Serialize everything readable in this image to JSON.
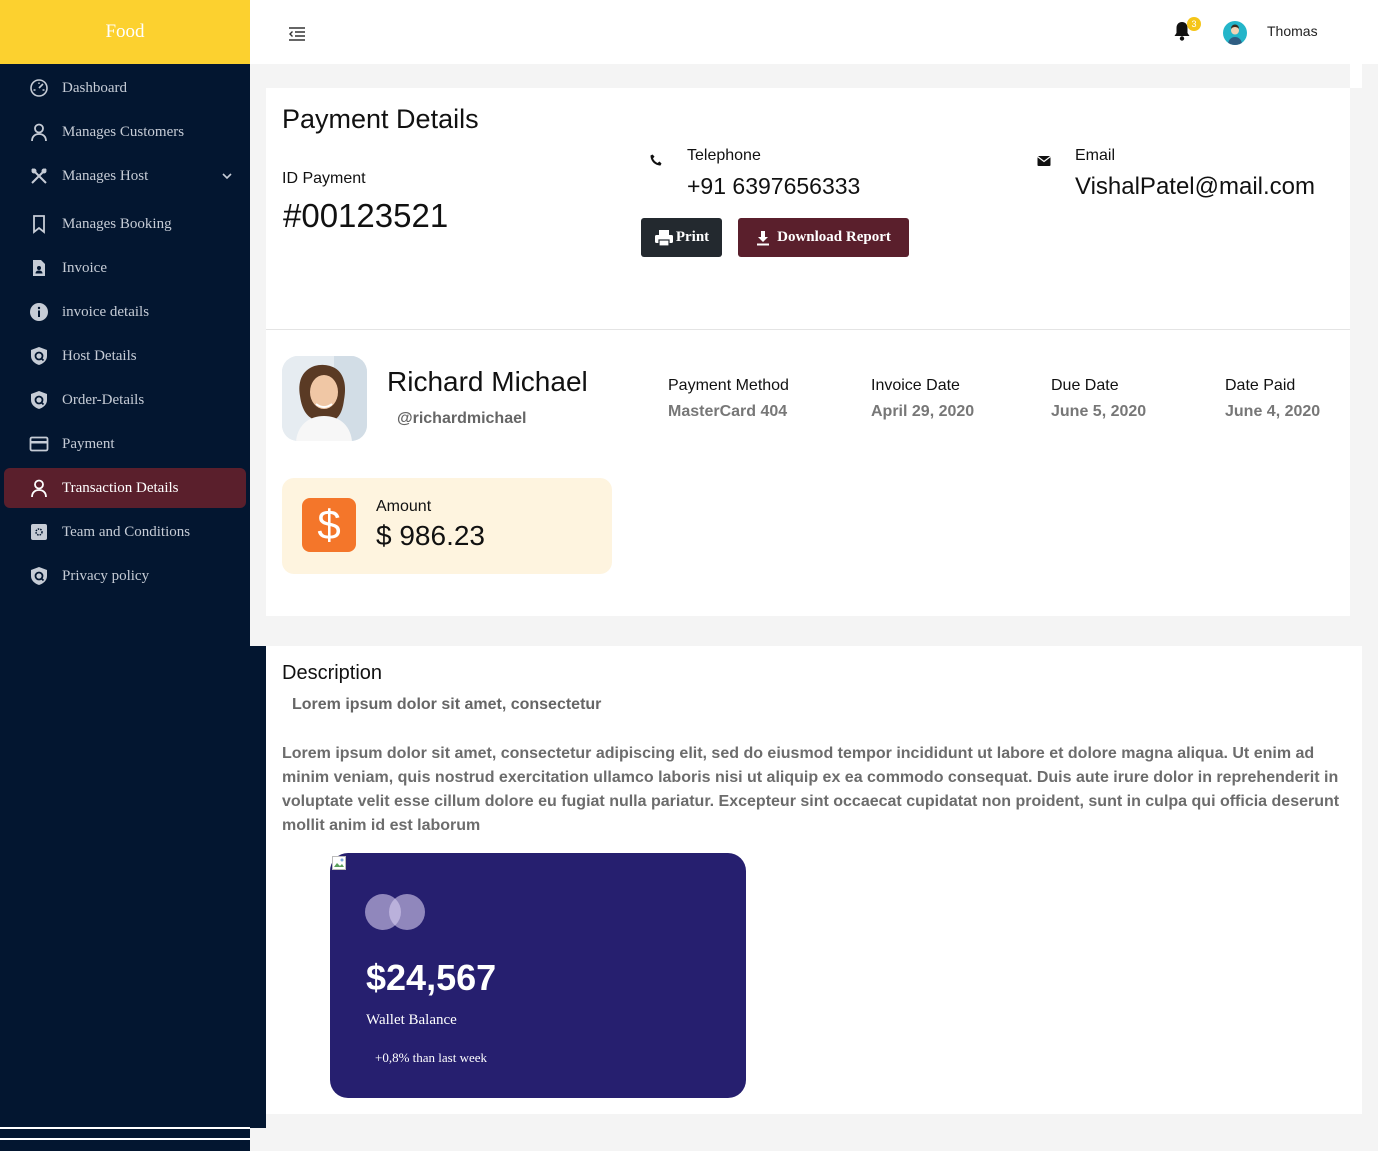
{
  "sidebar": {
    "logo": "Food",
    "items": [
      {
        "label": "Dashboard",
        "icon": "dashboard-gauge-icon"
      },
      {
        "label": "Manages Customers",
        "icon": "user-icon"
      },
      {
        "label": "Manages Host",
        "icon": "utensils-icon"
      },
      {
        "label": "Manages Booking",
        "icon": "bookmark-icon"
      },
      {
        "label": "Invoice",
        "icon": "document-user-icon"
      },
      {
        "label": "invoice details",
        "icon": "info-icon"
      },
      {
        "label": "Host Details",
        "icon": "shield-icon"
      },
      {
        "label": "Order-Details",
        "icon": "shield-icon"
      },
      {
        "label": "Payment",
        "icon": "credit-card-icon"
      },
      {
        "label": "Transaction Details",
        "icon": "user-icon"
      },
      {
        "label": "Team and Conditions",
        "icon": "settings-square-icon"
      },
      {
        "label": "Privacy policy",
        "icon": "shield-icon"
      }
    ],
    "active_item": "Transaction Details"
  },
  "header": {
    "notification_count": "3",
    "user_name": "Thomas"
  },
  "payment": {
    "title": "Payment Details",
    "id_label": "ID Payment",
    "id_value": "#00123521",
    "telephone_label": "Telephone",
    "telephone_value": "+91 6397656333",
    "email_label": "Email",
    "email_value": "VishalPatel@mail.com",
    "print_label": "Print",
    "download_label": "Download Report"
  },
  "customer": {
    "name": "Richard Michael",
    "handle": "@richardmichael"
  },
  "meta": {
    "payment_method_label": "Payment Method",
    "payment_method_value": "MasterCard 404",
    "invoice_date_label": "Invoice Date",
    "invoice_date_value": "April 29, 2020",
    "due_date_label": "Due Date",
    "due_date_value": "June 5, 2020",
    "date_paid_label": "Date Paid",
    "date_paid_value": "June 4, 2020"
  },
  "amount": {
    "label": "Amount",
    "value": "$ 986.23",
    "icon_symbol": "$"
  },
  "description": {
    "title": "Description",
    "subtitle": "Lorem ipsum dolor sit amet, consectetur",
    "body": "Lorem ipsum dolor sit amet, consectetur adipiscing elit, sed do eiusmod tempor incididunt ut labore et dolore magna aliqua. Ut enim ad minim veniam, quis nostrud exercitation ullamco laboris nisi ut aliquip ex ea commodo consequat. Duis aute irure dolor in reprehenderit in voluptate velit esse cillum dolore eu fugiat nulla pariatur. Excepteur sint occaecat cupidatat non proident, sunt in culpa qui officia deserunt mollit anim id est laborum"
  },
  "wallet": {
    "balance": "$24,567",
    "label": "Wallet Balance",
    "change": "+0,8% than last week"
  },
  "colors": {
    "sidebar_bg": "#031630",
    "logo_bg": "#fcd12f",
    "active_bg": "#5a1f2c",
    "print_bg": "#23292f",
    "download_bg": "#5a1f2c",
    "amount_bg": "#fef4df",
    "amount_icon_bg": "#f4762a",
    "wallet_bg": "#261f6f"
  }
}
